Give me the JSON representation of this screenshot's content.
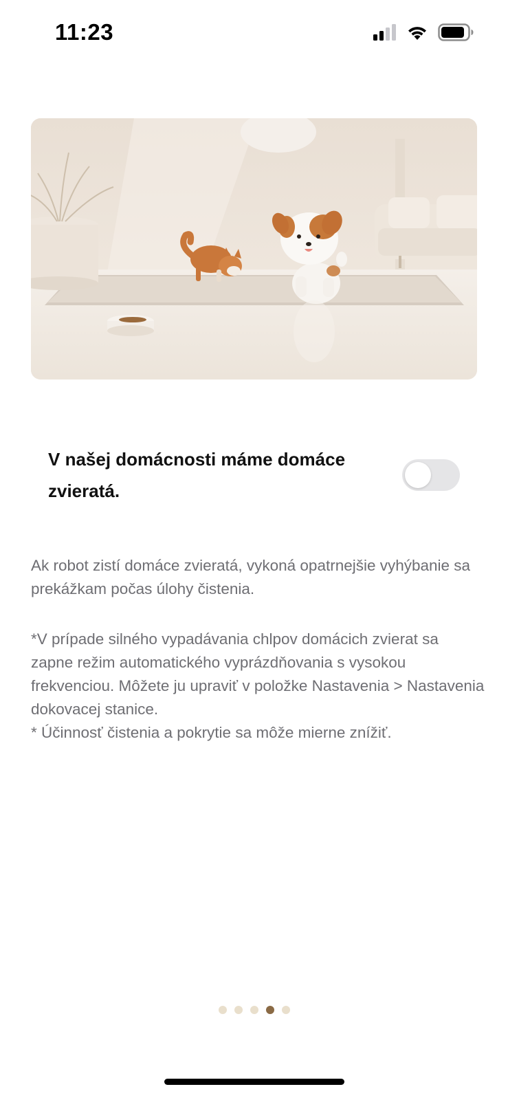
{
  "status_bar": {
    "time": "11:23",
    "icons": [
      "cellular-signal-icon",
      "wifi-icon",
      "battery-icon"
    ]
  },
  "hero": {
    "description_icon": "pets-illustration"
  },
  "pet_setting": {
    "label": "V našej domácnosti máme domáce zvieratá.",
    "enabled": false
  },
  "description": {
    "paragraph1": "Ak robot zistí domáce zvieratá, vykoná opatrnejšie vyhýbanie sa prekážkam počas úlohy čistenia.",
    "note1": "*V prípade silného vypadávania chlpov domácich zvierat sa zapne režim automatického vyprázdňovania s vysokou frekvenciou. Môžete ju upraviť v položke Nastavenia > Nastavenia dokovacej stanice.",
    "note2": "* Účinnosť čistenia a pokrytie sa môže mierne znížiť."
  },
  "pager": {
    "total": 5,
    "active_index": 3
  },
  "colors": {
    "toggle_off": "#e5e5e7",
    "pager_inactive": "#e9dfcc",
    "pager_active": "#8a6a45",
    "secondary_text": "#6e6e73"
  }
}
